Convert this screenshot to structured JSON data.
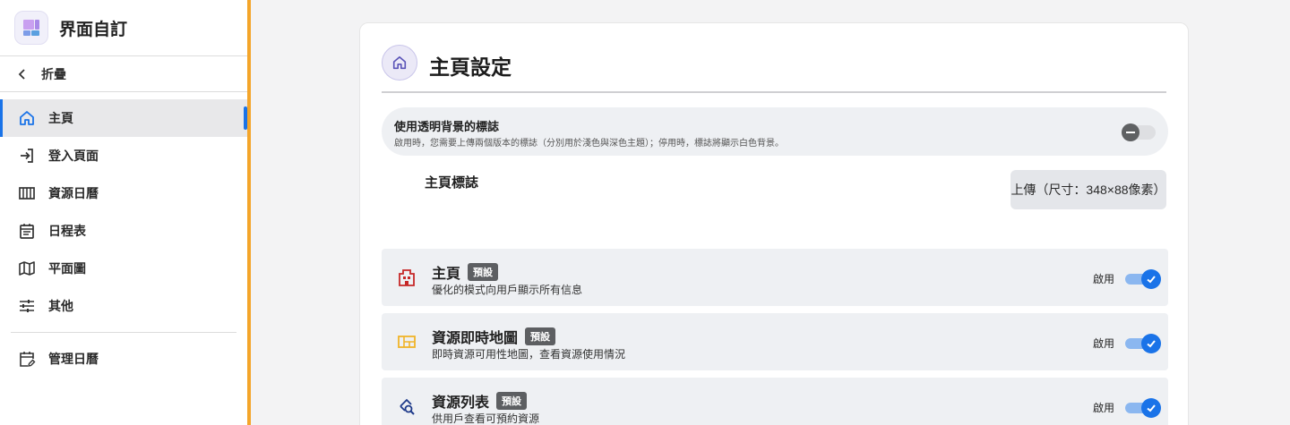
{
  "app": {
    "title": "界面自訂"
  },
  "sidebar": {
    "collapse_label": "折疊",
    "items": [
      {
        "label": "主頁",
        "icon": "home-icon",
        "active": true
      },
      {
        "label": "登入頁面",
        "icon": "login-icon"
      },
      {
        "label": "資源日曆",
        "icon": "calendar-columns-icon"
      },
      {
        "label": "日程表",
        "icon": "schedule-icon"
      },
      {
        "label": "平面圖",
        "icon": "map-icon"
      },
      {
        "label": "其他",
        "icon": "sliders-icon"
      }
    ],
    "manage_label": "管理日曆"
  },
  "main": {
    "title": "主頁設定",
    "transparent_logo": {
      "title": "使用透明背景的標誌",
      "description": "啟用時，您需要上傳兩個版本的標誌（分別用於淺色與深色主題）；停用時，標誌將顯示白色背景。",
      "enabled": false
    },
    "home_logo_label": "主頁標誌",
    "upload_label": "上傳（尺寸：348×88像素）",
    "modules": [
      {
        "title": "主頁",
        "tag": "預設",
        "description": "優化的模式向用戶顯示所有信息",
        "enable_label": "啟用",
        "enabled": true,
        "icon": "building-icon"
      },
      {
        "title": "資源即時地圖",
        "tag": "預設",
        "description": "即時資源可用性地圖，查看資源使用情況",
        "enable_label": "啟用",
        "enabled": true,
        "icon": "floor-map-icon"
      },
      {
        "title": "資源列表",
        "tag": "預設",
        "description": "供用戶查看可預約資源",
        "enable_label": "啟用",
        "enabled": true,
        "icon": "resource-search-icon"
      }
    ]
  },
  "colors": {
    "accent": "#1a73e8",
    "sidebar_border": "#f4a52a"
  }
}
